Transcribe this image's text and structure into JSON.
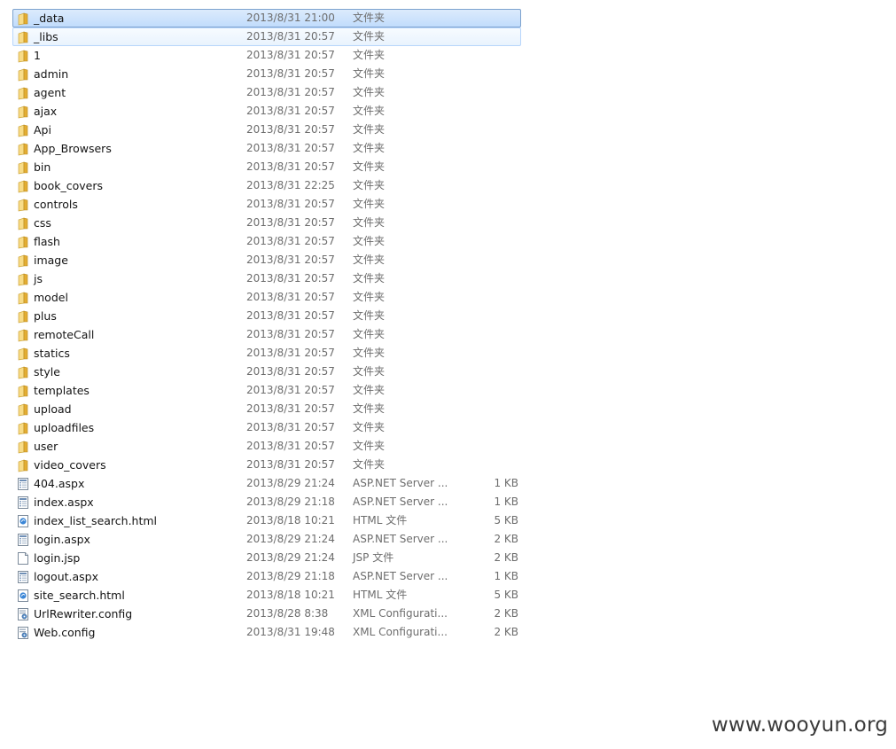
{
  "files": [
    {
      "name": "_data",
      "date": "2013/8/31 21:00",
      "type": "文件夹",
      "size": "",
      "icon": "folder-icon",
      "state": "selected"
    },
    {
      "name": "_libs",
      "date": "2013/8/31 20:57",
      "type": "文件夹",
      "size": "",
      "icon": "folder-icon",
      "state": "hover"
    },
    {
      "name": "1",
      "date": "2013/8/31 20:57",
      "type": "文件夹",
      "size": "",
      "icon": "folder-icon",
      "state": ""
    },
    {
      "name": "admin",
      "date": "2013/8/31 20:57",
      "type": "文件夹",
      "size": "",
      "icon": "folder-icon",
      "state": ""
    },
    {
      "name": "agent",
      "date": "2013/8/31 20:57",
      "type": "文件夹",
      "size": "",
      "icon": "folder-icon",
      "state": ""
    },
    {
      "name": "ajax",
      "date": "2013/8/31 20:57",
      "type": "文件夹",
      "size": "",
      "icon": "folder-icon",
      "state": ""
    },
    {
      "name": "Api",
      "date": "2013/8/31 20:57",
      "type": "文件夹",
      "size": "",
      "icon": "folder-icon",
      "state": ""
    },
    {
      "name": "App_Browsers",
      "date": "2013/8/31 20:57",
      "type": "文件夹",
      "size": "",
      "icon": "folder-icon",
      "state": ""
    },
    {
      "name": "bin",
      "date": "2013/8/31 20:57",
      "type": "文件夹",
      "size": "",
      "icon": "folder-icon",
      "state": ""
    },
    {
      "name": "book_covers",
      "date": "2013/8/31 22:25",
      "type": "文件夹",
      "size": "",
      "icon": "folder-icon",
      "state": ""
    },
    {
      "name": "controls",
      "date": "2013/8/31 20:57",
      "type": "文件夹",
      "size": "",
      "icon": "folder-icon",
      "state": ""
    },
    {
      "name": "css",
      "date": "2013/8/31 20:57",
      "type": "文件夹",
      "size": "",
      "icon": "folder-icon",
      "state": ""
    },
    {
      "name": "flash",
      "date": "2013/8/31 20:57",
      "type": "文件夹",
      "size": "",
      "icon": "folder-icon",
      "state": ""
    },
    {
      "name": "image",
      "date": "2013/8/31 20:57",
      "type": "文件夹",
      "size": "",
      "icon": "folder-icon",
      "state": ""
    },
    {
      "name": "js",
      "date": "2013/8/31 20:57",
      "type": "文件夹",
      "size": "",
      "icon": "folder-icon",
      "state": ""
    },
    {
      "name": "model",
      "date": "2013/8/31 20:57",
      "type": "文件夹",
      "size": "",
      "icon": "folder-icon",
      "state": ""
    },
    {
      "name": "plus",
      "date": "2013/8/31 20:57",
      "type": "文件夹",
      "size": "",
      "icon": "folder-icon",
      "state": ""
    },
    {
      "name": "remoteCall",
      "date": "2013/8/31 20:57",
      "type": "文件夹",
      "size": "",
      "icon": "folder-icon",
      "state": ""
    },
    {
      "name": "statics",
      "date": "2013/8/31 20:57",
      "type": "文件夹",
      "size": "",
      "icon": "folder-icon",
      "state": ""
    },
    {
      "name": "style",
      "date": "2013/8/31 20:57",
      "type": "文件夹",
      "size": "",
      "icon": "folder-icon",
      "state": ""
    },
    {
      "name": "templates",
      "date": "2013/8/31 20:57",
      "type": "文件夹",
      "size": "",
      "icon": "folder-icon",
      "state": ""
    },
    {
      "name": "upload",
      "date": "2013/8/31 20:57",
      "type": "文件夹",
      "size": "",
      "icon": "folder-icon",
      "state": ""
    },
    {
      "name": "uploadfiles",
      "date": "2013/8/31 20:57",
      "type": "文件夹",
      "size": "",
      "icon": "folder-icon",
      "state": ""
    },
    {
      "name": "user",
      "date": "2013/8/31 20:57",
      "type": "文件夹",
      "size": "",
      "icon": "folder-icon",
      "state": ""
    },
    {
      "name": "video_covers",
      "date": "2013/8/31 20:57",
      "type": "文件夹",
      "size": "",
      "icon": "folder-icon",
      "state": ""
    },
    {
      "name": "404.aspx",
      "date": "2013/8/29 21:24",
      "type": "ASP.NET Server ...",
      "size": "1 KB",
      "icon": "aspx-file-icon",
      "state": ""
    },
    {
      "name": "index.aspx",
      "date": "2013/8/29 21:18",
      "type": "ASP.NET Server ...",
      "size": "1 KB",
      "icon": "aspx-file-icon",
      "state": ""
    },
    {
      "name": "index_list_search.html",
      "date": "2013/8/18 10:21",
      "type": "HTML 文件",
      "size": "5 KB",
      "icon": "html-file-icon",
      "state": ""
    },
    {
      "name": "login.aspx",
      "date": "2013/8/29 21:24",
      "type": "ASP.NET Server ...",
      "size": "2 KB",
      "icon": "aspx-file-icon",
      "state": ""
    },
    {
      "name": "login.jsp",
      "date": "2013/8/29 21:24",
      "type": "JSP 文件",
      "size": "2 KB",
      "icon": "jsp-file-icon",
      "state": ""
    },
    {
      "name": "logout.aspx",
      "date": "2013/8/29 21:18",
      "type": "ASP.NET Server ...",
      "size": "1 KB",
      "icon": "aspx-file-icon",
      "state": ""
    },
    {
      "name": "site_search.html",
      "date": "2013/8/18 10:21",
      "type": "HTML 文件",
      "size": "5 KB",
      "icon": "html-file-icon",
      "state": ""
    },
    {
      "name": "UrlRewriter.config",
      "date": "2013/8/28 8:38",
      "type": "XML Configurati...",
      "size": "2 KB",
      "icon": "config-file-icon",
      "state": ""
    },
    {
      "name": "Web.config",
      "date": "2013/8/31 19:48",
      "type": "XML Configurati...",
      "size": "2 KB",
      "icon": "config-file-icon",
      "state": ""
    }
  ],
  "watermark": "www.wooyun.org",
  "colors": {
    "selected_bg": "#c9e0fc",
    "selected_border": "#7da2ce",
    "hover_bg": "#eef5fd",
    "hover_border": "#b8d6fb",
    "folder": "#e8b93f"
  }
}
